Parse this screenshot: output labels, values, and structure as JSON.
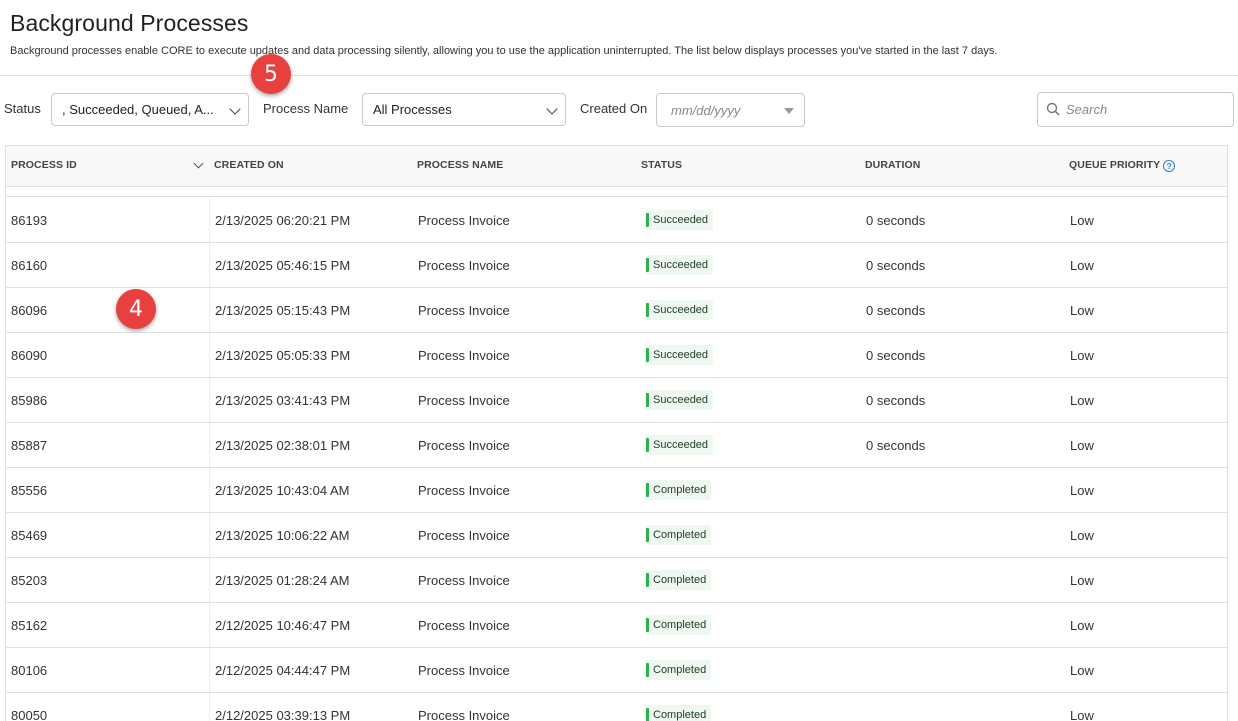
{
  "header": {
    "title": "Background Processes",
    "description": "Background processes enable CORE to execute updates and data processing silently, allowing you to use the application uninterrupted. The list below displays processes you've started in the last 7 days."
  },
  "filters": {
    "status_label": "Status",
    "status_value": ", Succeeded, Queued, A...",
    "process_name_label": "Process Name",
    "process_name_value": "All Processes",
    "created_on_label": "Created On",
    "created_on_placeholder": "mm/dd/yyyy",
    "search_placeholder": "Search"
  },
  "table": {
    "columns": [
      "PROCESS ID",
      "CREATED ON",
      "PROCESS NAME",
      "STATUS",
      "DURATION",
      "QUEUE PRIORITY"
    ],
    "rows": [
      {
        "id": "86193",
        "created": "2/13/2025 06:20:21 PM",
        "name": "Process Invoice",
        "status": "Succeeded",
        "duration": "0 seconds",
        "priority": "Low"
      },
      {
        "id": "86160",
        "created": "2/13/2025 05:46:15 PM",
        "name": "Process Invoice",
        "status": "Succeeded",
        "duration": "0 seconds",
        "priority": "Low"
      },
      {
        "id": "86096",
        "created": "2/13/2025 05:15:43 PM",
        "name": "Process Invoice",
        "status": "Succeeded",
        "duration": "0 seconds",
        "priority": "Low"
      },
      {
        "id": "86090",
        "created": "2/13/2025 05:05:33 PM",
        "name": "Process Invoice",
        "status": "Succeeded",
        "duration": "0 seconds",
        "priority": "Low"
      },
      {
        "id": "85986",
        "created": "2/13/2025 03:41:43 PM",
        "name": "Process Invoice",
        "status": "Succeeded",
        "duration": "0 seconds",
        "priority": "Low"
      },
      {
        "id": "85887",
        "created": "2/13/2025 02:38:01 PM",
        "name": "Process Invoice",
        "status": "Succeeded",
        "duration": "0 seconds",
        "priority": "Low"
      },
      {
        "id": "85556",
        "created": "2/13/2025 10:43:04 AM",
        "name": "Process Invoice",
        "status": "Completed",
        "duration": "",
        "priority": "Low"
      },
      {
        "id": "85469",
        "created": "2/13/2025 10:06:22 AM",
        "name": "Process Invoice",
        "status": "Completed",
        "duration": "",
        "priority": "Low"
      },
      {
        "id": "85203",
        "created": "2/13/2025 01:28:24 AM",
        "name": "Process Invoice",
        "status": "Completed",
        "duration": "",
        "priority": "Low"
      },
      {
        "id": "85162",
        "created": "2/12/2025 10:46:47 PM",
        "name": "Process Invoice",
        "status": "Completed",
        "duration": "",
        "priority": "Low"
      },
      {
        "id": "80106",
        "created": "2/12/2025 04:44:47 PM",
        "name": "Process Invoice",
        "status": "Completed",
        "duration": "",
        "priority": "Low"
      },
      {
        "id": "80050",
        "created": "2/12/2025 03:39:13 PM",
        "name": "Process Invoice",
        "status": "Completed",
        "duration": "",
        "priority": "Low"
      }
    ]
  },
  "annotations": {
    "marker_a": "5",
    "marker_b": "4"
  },
  "colors": {
    "status_accent": "#2bb24c",
    "marker": "#e8403e"
  }
}
